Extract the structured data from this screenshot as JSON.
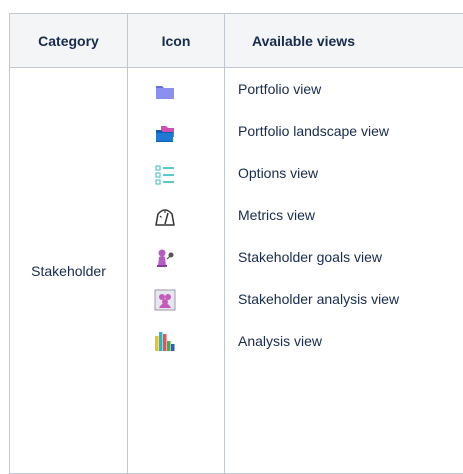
{
  "table": {
    "headers": {
      "category": "Category",
      "icon": "Icon",
      "views": "Available views"
    },
    "row": {
      "category": "Stakeholder",
      "icons": [
        "folder-icon",
        "folder-stack-icon",
        "checklist-icon",
        "gauge-icon",
        "stakeholder-target-icon",
        "people-icon",
        "bar-chart-icon"
      ],
      "views": [
        "Portfolio view",
        "Portfolio landscape view",
        "Options view",
        "Metrics view",
        "Stakeholder goals view",
        "Stakeholder analysis view",
        "Analysis view"
      ]
    }
  }
}
